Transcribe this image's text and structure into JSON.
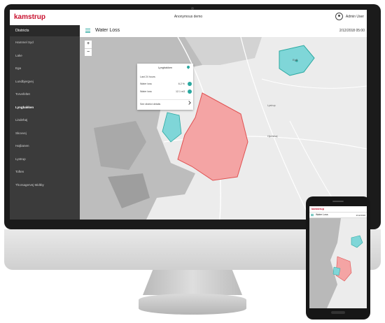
{
  "app": {
    "logo": "kamstrup",
    "title": "Anonymous demo",
    "user": "Admin User"
  },
  "header": {
    "title": "Water Loss",
    "date": "2/12/2018 05:00"
  },
  "sidebar": {
    "title": "Districts",
    "items": [
      {
        "label": "Hammel Syd"
      },
      {
        "label": "Lake"
      },
      {
        "label": "Ega"
      },
      {
        "label": "Lundbjergvej"
      },
      {
        "label": "Torvefeltet"
      },
      {
        "label": "Lyngbakken",
        "active": true
      },
      {
        "label": "Lindehøj"
      },
      {
        "label": "Skovvej"
      },
      {
        "label": "Højbanen"
      },
      {
        "label": "Lystrup"
      },
      {
        "label": "Toften"
      },
      {
        "label": "Thorsagervej Midtby"
      }
    ]
  },
  "popup": {
    "title": "Lyngbakken",
    "subtitle": "Last 24 hours",
    "rows": [
      {
        "label": "Water loss",
        "value": "6.2 %"
      },
      {
        "label": "Water loss",
        "value": "12.1 m3"
      }
    ],
    "link": "See district details"
  },
  "map": {
    "zoom_in": "+",
    "zoom_out": "−",
    "labels": {
      "district_a": "Egå",
      "town_1": "Lystrup",
      "town_2": "Hjortshøj"
    }
  },
  "phone": {
    "logo": "kamstrup",
    "title": "Water Loss",
    "date": "2/12/2018"
  },
  "colors": {
    "brand_red": "#c8102e",
    "accent_teal": "#2aa8a0",
    "loss_high": "#f4a4a4",
    "loss_ok": "#7fd6d8"
  }
}
